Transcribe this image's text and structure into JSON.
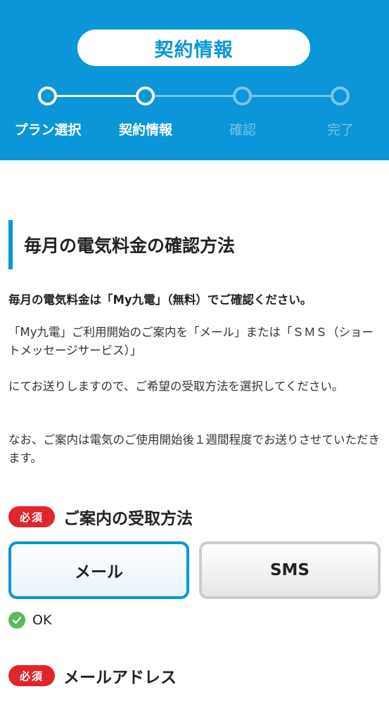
{
  "header": {
    "title": "契約情報",
    "steps": [
      {
        "label": "プラン選択",
        "state": "done"
      },
      {
        "label": "契約情報",
        "state": "current"
      },
      {
        "label": "確認",
        "state": "future"
      },
      {
        "label": "完了",
        "state": "future"
      }
    ],
    "colors": {
      "primary": "#0a96d8",
      "future": "#7dc3ea"
    }
  },
  "section": {
    "heading": "毎月の電気料金の確認方法",
    "intro_bold": "毎月の電気料金は「My九電」（無料）でご確認ください。",
    "paragraphs": [
      "「My九電」ご利用開始のご案内を「メール」または「ＳＭＳ（ショートメッセージサービス）」",
      "にてお送りしますので、ご希望の受取方法を選択してください。",
      "なお、ご案内は電気のご使用開始後１週間程度でお送りさせていただきます。"
    ]
  },
  "receipt_field": {
    "required_badge": "必須",
    "label": "ご案内の受取方法",
    "options": [
      {
        "label": "メール",
        "selected": true
      },
      {
        "label": "SMS",
        "selected": false
      }
    ],
    "validation": "OK"
  },
  "email_field": {
    "required_badge": "必須",
    "label": "メールアドレス"
  }
}
